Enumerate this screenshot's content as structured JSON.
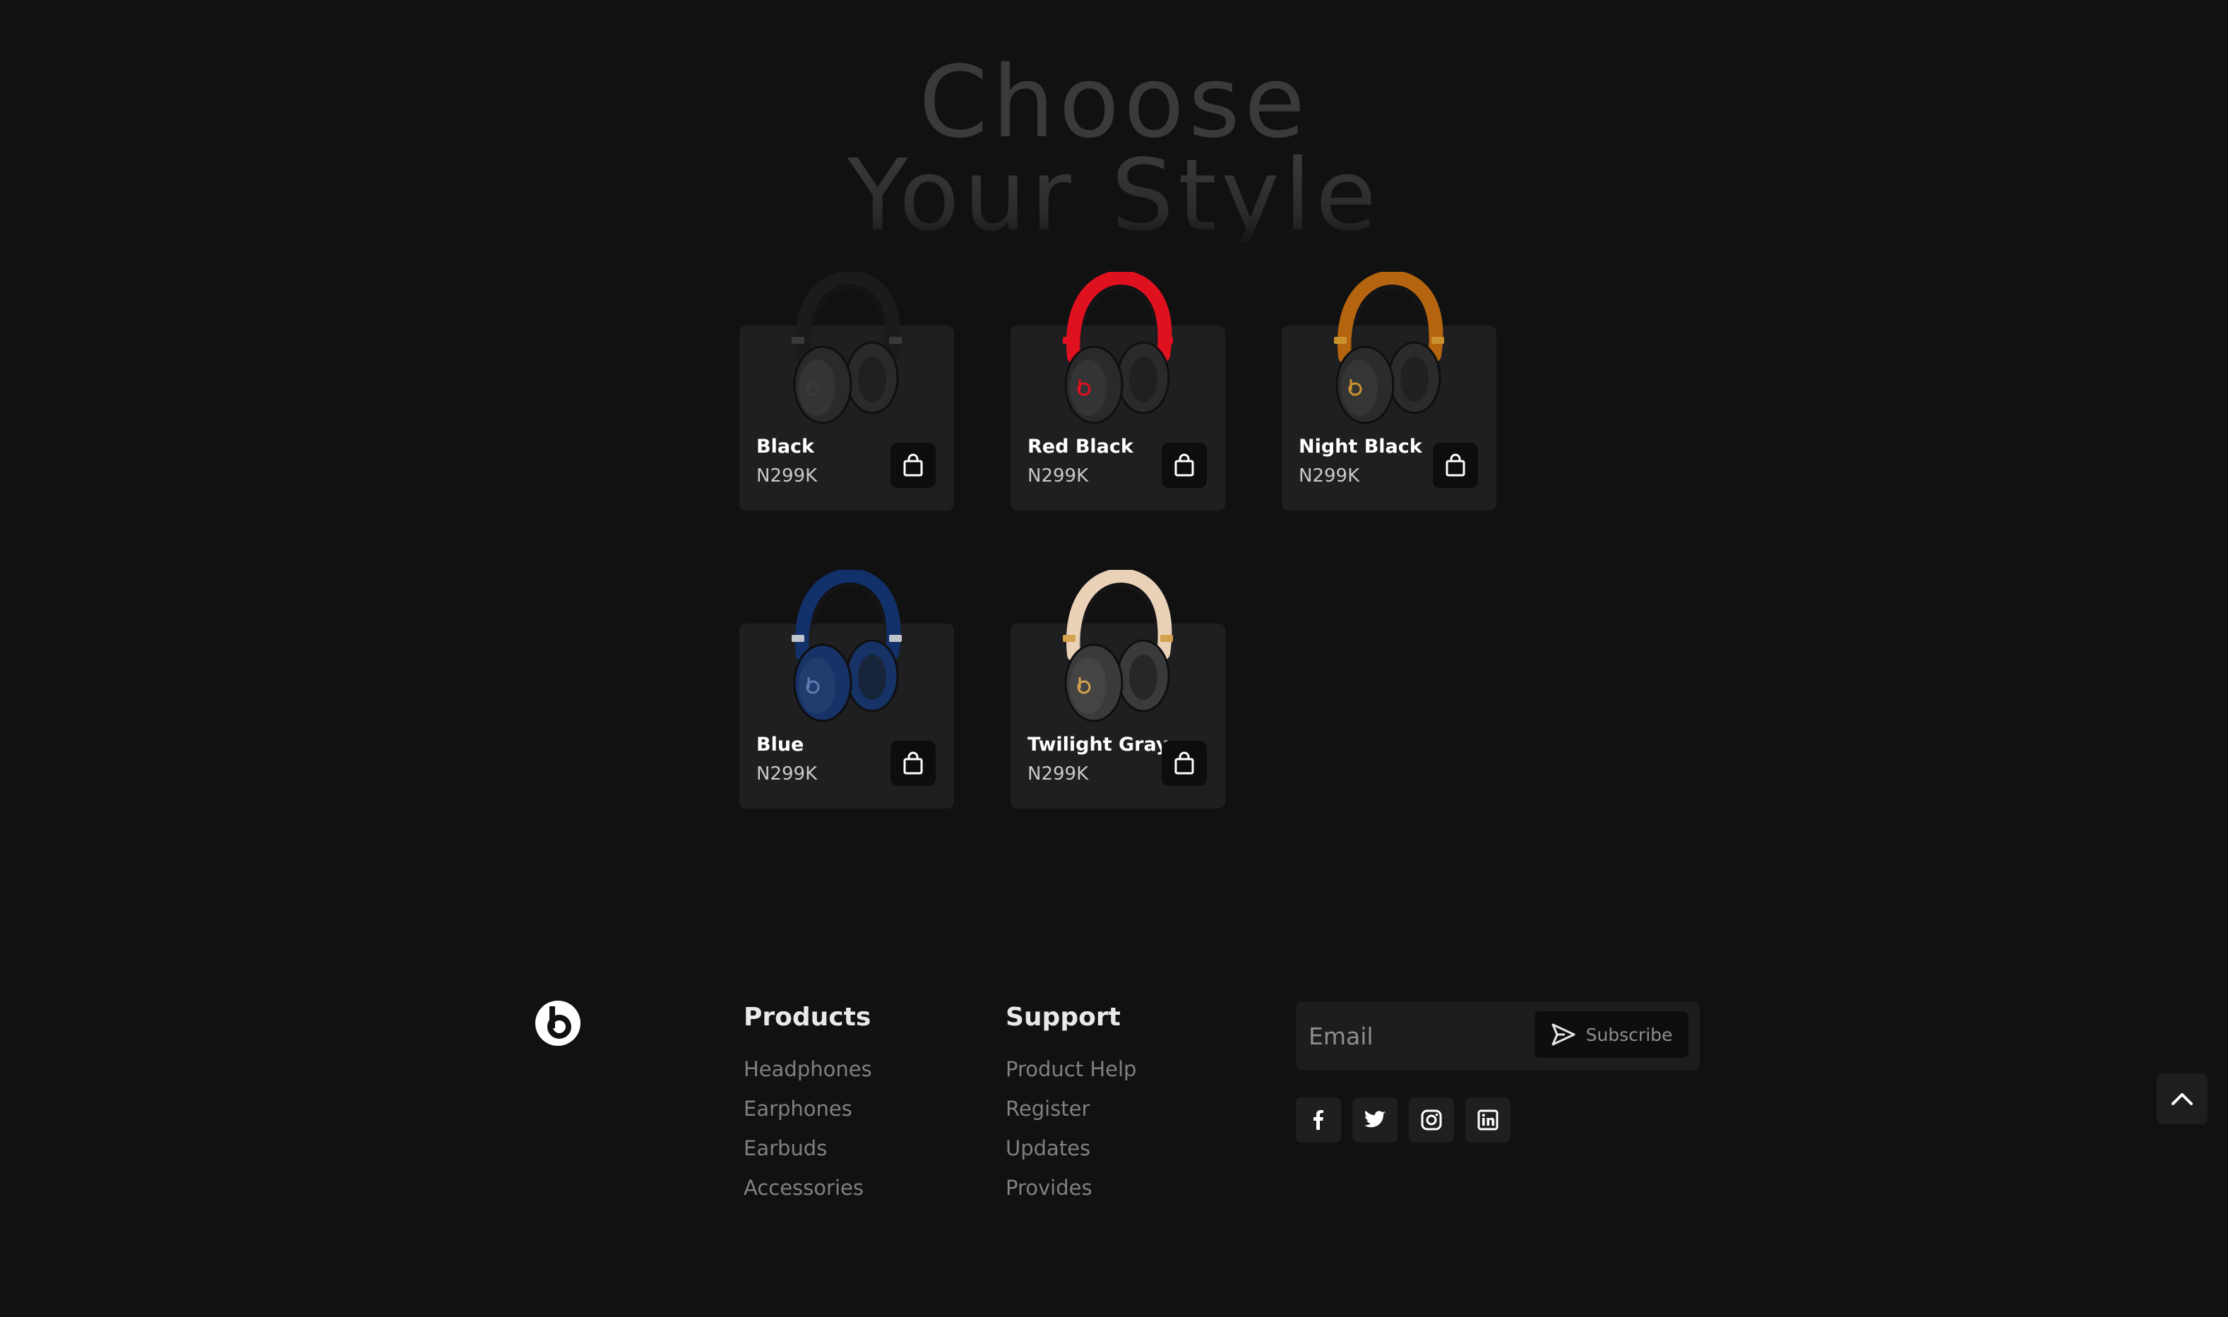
{
  "heading": {
    "line1": "Choose",
    "line2": "Your Style"
  },
  "products": [
    {
      "name": "Black",
      "price": "N299K",
      "band": "#1b1b1c",
      "cup": "#2a2a2c",
      "accent": "#3a3a3c",
      "logo": "#3a3a3c",
      "icon": "shopping-bag-icon"
    },
    {
      "name": "Red Black",
      "price": "N299K",
      "band": "#e0111f",
      "cup": "#2a2a2c",
      "accent": "#e0111f",
      "logo": "#e0111f",
      "icon": "shopping-bag-icon"
    },
    {
      "name": "Night Black",
      "price": "N299K",
      "band": "#b5650f",
      "cup": "#2b2b2c",
      "accent": "#c9922e",
      "logo": "#c9922e",
      "icon": "shopping-bag-icon"
    },
    {
      "name": "Blue",
      "price": "N299K",
      "band": "#12306a",
      "cup": "#163266",
      "accent": "#c0c4cc",
      "logo": "#5d7cb3",
      "icon": "shopping-bag-icon"
    },
    {
      "name": "Twilight Gray",
      "price": "N299K",
      "band": "#ead2b8",
      "cup": "#3a3a3c",
      "accent": "#d4a24e",
      "logo": "#d4a24e",
      "icon": "shopping-bag-icon"
    }
  ],
  "footer": {
    "logo_icon": "beats-logo-icon",
    "products": {
      "title": "Products",
      "links": [
        "Headphones",
        "Earphones",
        "Earbuds",
        "Accessories"
      ]
    },
    "support": {
      "title": "Support",
      "links": [
        "Product Help",
        "Register",
        "Updates",
        "Provides"
      ]
    },
    "newsletter": {
      "placeholder": "Email",
      "button_label": "Subscribe",
      "button_icon": "send-icon"
    },
    "social_icons": [
      "facebook-icon",
      "twitter-icon",
      "instagram-icon",
      "linkedin-icon"
    ],
    "back_to_top_icon": "chevron-up-icon"
  },
  "colors": {
    "background": "#111112",
    "card": "#1f1f21",
    "text_muted": "#808083"
  }
}
